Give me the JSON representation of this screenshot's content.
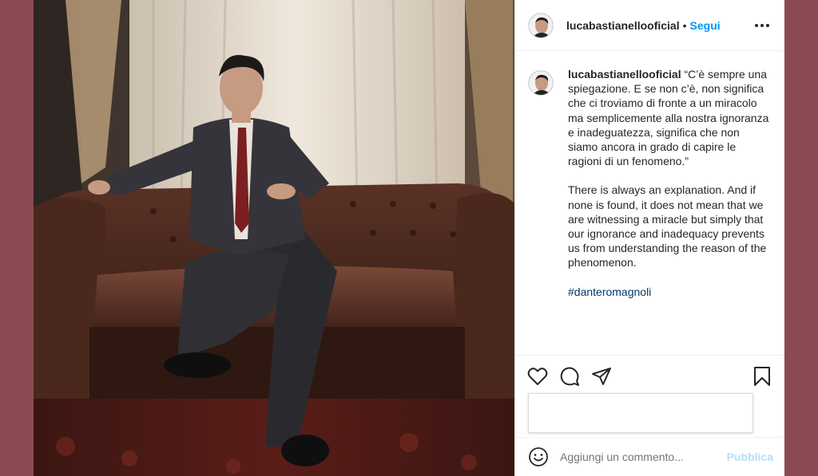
{
  "post": {
    "username": "lucabastianellooficial",
    "separator": "•",
    "follow_label": "Segui",
    "caption": {
      "username": "lucabastianellooficial",
      "italian": "“C’è sempre una spiegazione. E se non c’è, non significa che ci troviamo di fronte a un miracolo ma semplicemente alla nostra ignoranza e inadeguatezza, significa che non siamo ancora in grado di capire le ragioni di un fenomeno.”",
      "english": "There is always an explanation. And if none is found, it does not mean that we are witnessing a miracle but simply that our ignorance and inadequacy prevents us from understanding the reason of the phenomenon.",
      "hashtag": "#danteromagnoli"
    },
    "comment": {
      "placeholder": "Aggiungi un commento...",
      "publish_label": "Pubblica"
    },
    "icons": {
      "more": "more-options-icon",
      "like": "heart-icon",
      "comment": "comment-icon",
      "share": "share-icon",
      "save": "bookmark-icon",
      "emoji": "emoji-icon"
    },
    "colors": {
      "background": "#8c4a52",
      "follow": "#0095f6",
      "hashtag": "#00376b",
      "publish": "#b2dffc"
    }
  }
}
